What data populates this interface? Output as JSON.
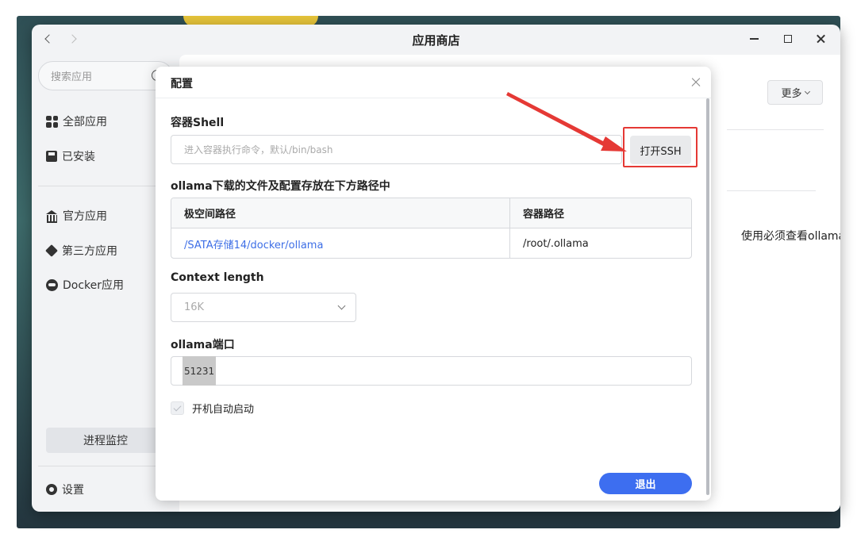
{
  "window": {
    "title": "应用商店"
  },
  "sidebar": {
    "search_placeholder": "搜索应用",
    "items": [
      {
        "label": "全部应用",
        "icon": "grid-icon"
      },
      {
        "label": "已安装",
        "icon": "save-icon"
      },
      {
        "label": "官方应用",
        "icon": "bank-icon"
      },
      {
        "label": "第三方应用",
        "icon": "cube-icon"
      },
      {
        "label": "Docker应用",
        "icon": "docker-icon"
      }
    ],
    "monitor_label": "进程监控",
    "settings_label": "设置"
  },
  "content": {
    "more_label": "更多",
    "background_text": "使用必须查看ollama"
  },
  "dialog": {
    "title": "配置",
    "shell_label": "容器Shell",
    "shell_placeholder": "进入容器执行命令，默认/bin/bash",
    "ssh_button": "打开SSH",
    "path_section_label": "ollama下载的文件及配置存放在下方路径中",
    "path_headers": [
      "极空间路径",
      "容器路径"
    ],
    "path_rows": [
      [
        "/SATA存储14/docker/ollama",
        "/root/.ollama"
      ]
    ],
    "context_label": "Context length",
    "context_value": "16K",
    "port_label": "ollama端口",
    "port_value": "51231",
    "autostart_label": "开机自动启动",
    "exit_button": "退出"
  },
  "colors": {
    "accent": "#3d6ef0",
    "annotation": "#e53935",
    "link": "#3d6ee6"
  }
}
